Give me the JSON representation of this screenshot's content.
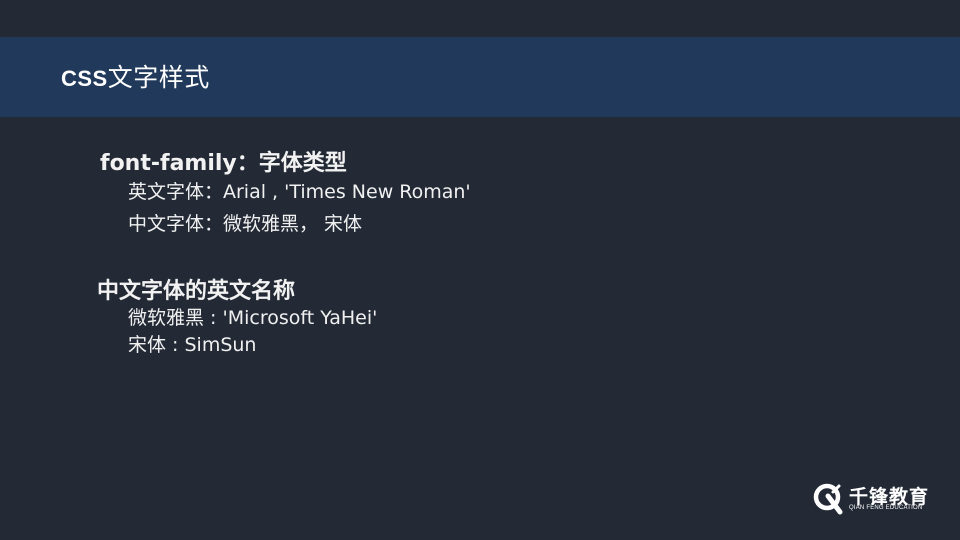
{
  "slide": {
    "title_latin": "CSS",
    "title_cjk": "文字样式",
    "section1": {
      "heading": "font-family：字体类型",
      "lines": [
        "英文字体：Arial , 'Times New Roman'",
        "中文字体：微软雅黑， 宋体"
      ]
    },
    "section2": {
      "heading": "中文字体的英文名称",
      "lines": [
        "微软雅黑 : 'Microsoft YaHei'",
        "宋体 : SimSun"
      ]
    }
  },
  "logo": {
    "name": "千锋教育",
    "subtitle": "QIAN FENG EDUCATION",
    "icon": "qianfeng-logo-icon"
  },
  "colors": {
    "background": "#232a36",
    "title_bar": "#213a5c",
    "text": "#ffffff"
  }
}
